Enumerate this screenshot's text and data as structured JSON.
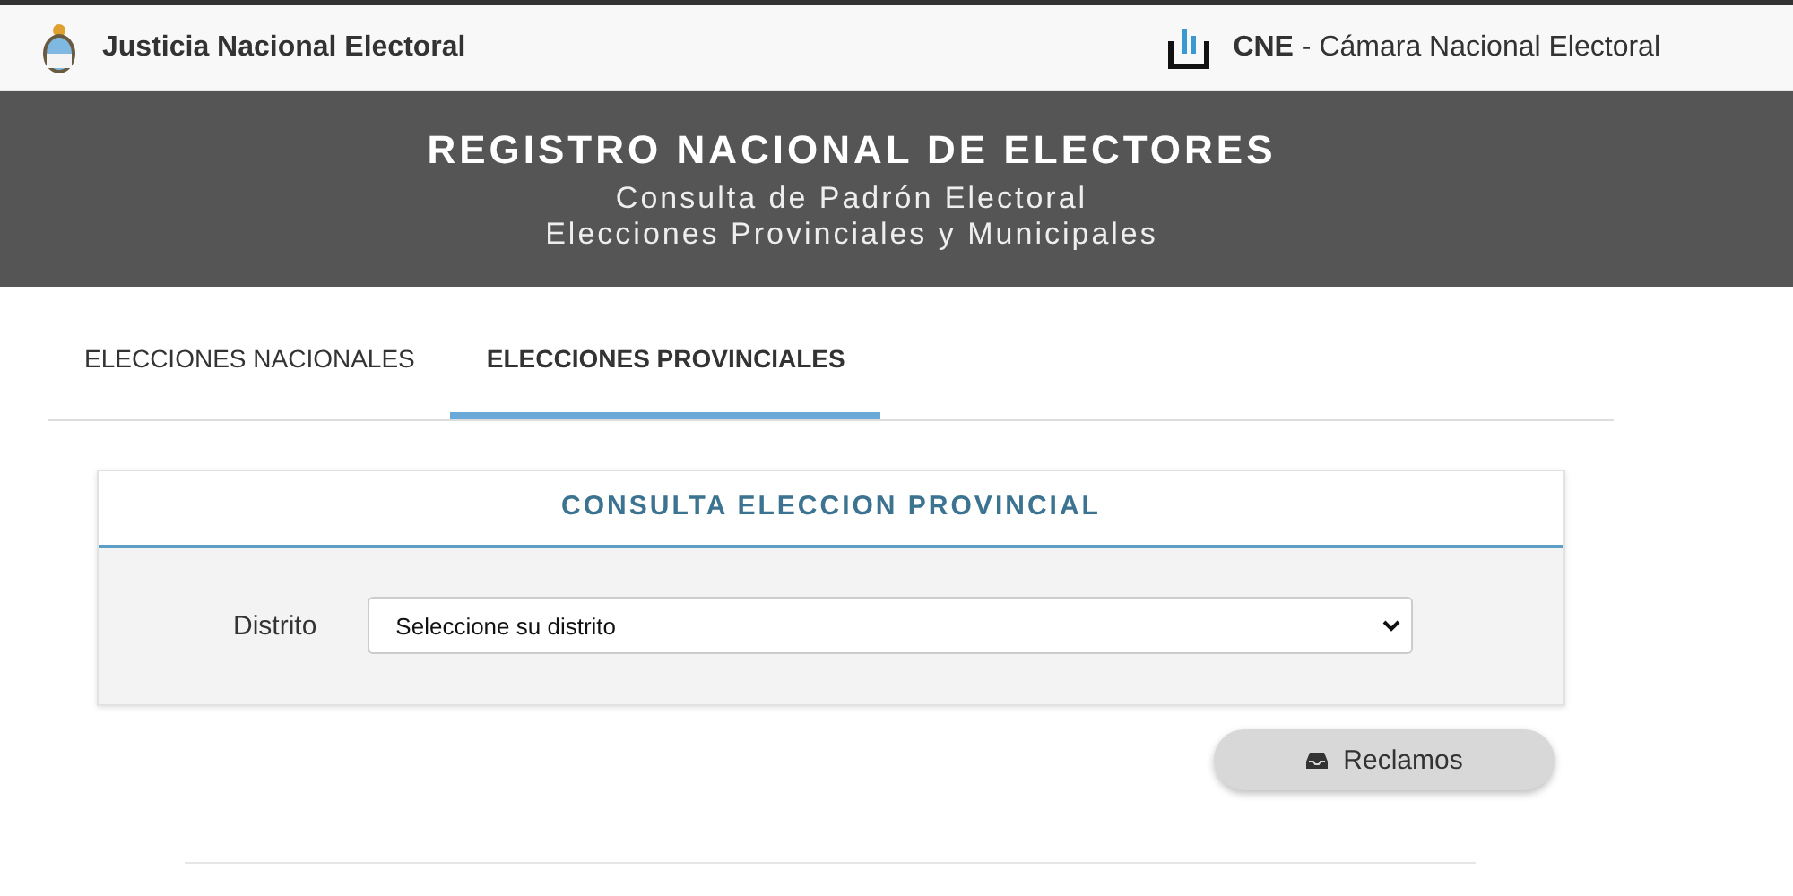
{
  "topbar": {
    "left_title": "Justicia Nacional Electoral",
    "right_title": "**CNE** - Cámara Nacional Electoral"
  },
  "banner": {
    "title": "REGISTRO NACIONAL DE ELECTORES",
    "subtitle": "Consulta de Padrón Electoral",
    "subtitle_2": "Elecciones Provinciales y Municipales"
  },
  "tabs": [
    {
      "label": "ELECCIONES NACIONALES",
      "selected": false
    },
    {
      "label": "ELECCIONES PROVINCIALES",
      "selected": true
    }
  ],
  "panel": {
    "title": "CONSULTA ELECCION PROVINCIAL",
    "field_label": "Distrito",
    "select": {
      "value": "Seleccione su distrito"
    }
  },
  "buttons": [
    {
      "label": "Reclamos"
    }
  ]
}
